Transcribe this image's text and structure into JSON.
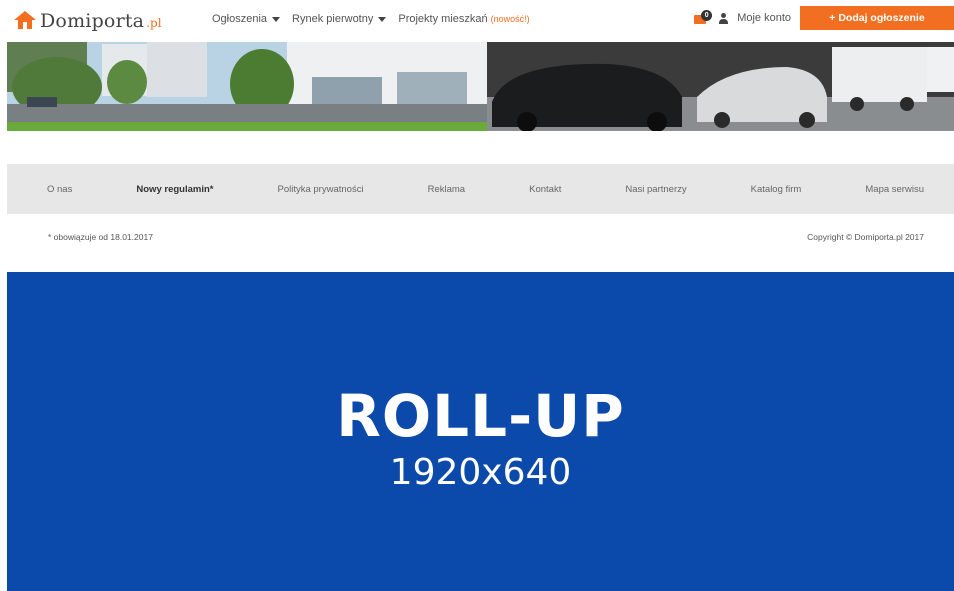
{
  "header": {
    "logo_text": "Domiporta",
    "logo_suffix": ".pl",
    "nav": [
      {
        "label": "Ogłoszenia"
      },
      {
        "label": "Rynek pierwotny"
      },
      {
        "label": "Projekty mieszkań",
        "tag": "(nowość!)"
      }
    ],
    "messages_count": "0",
    "account_label": "Moje konto",
    "add_button_label": "+ Dodaj ogłoszenie"
  },
  "footer_nav": [
    "O nas",
    "Nowy regulamin*",
    "Polityka prywatności",
    "Reklama",
    "Kontakt",
    "Nasi partnerzy",
    "Katalog firm",
    "Mapa serwisu"
  ],
  "footer_note": "* obowiązuje od 18.01.2017",
  "copyright": "Copyright © Domiporta.pl 2017",
  "rollup": {
    "title": "ROLL-UP",
    "size": "1920x640"
  },
  "colors": {
    "accent": "#f26f21",
    "rollup_bg": "#0b4aaa",
    "footer_bg": "#e7e7e7"
  }
}
